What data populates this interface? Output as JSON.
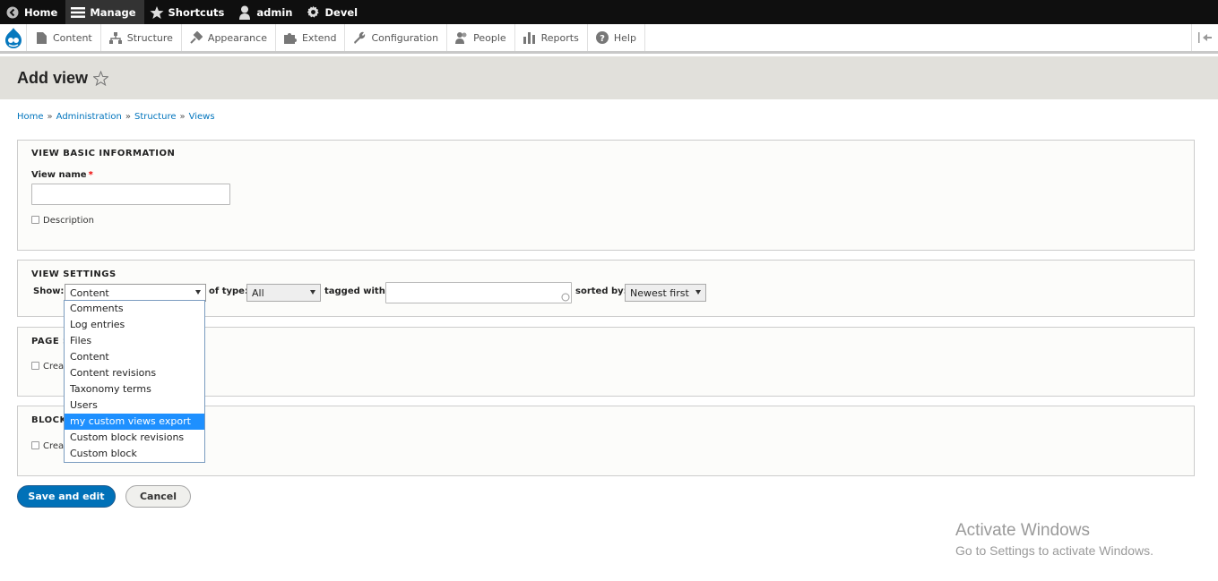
{
  "toolbar": {
    "items": [
      {
        "label": "Home",
        "icon": "back-circle-icon"
      },
      {
        "label": "Manage",
        "icon": "menu-icon"
      },
      {
        "label": "Shortcuts",
        "icon": "star-icon"
      },
      {
        "label": "admin",
        "icon": "user-icon"
      },
      {
        "label": "Devel",
        "icon": "gear-icon"
      }
    ]
  },
  "tray": {
    "items": [
      {
        "label": "Content",
        "icon": "document-icon"
      },
      {
        "label": "Structure",
        "icon": "structure-icon"
      },
      {
        "label": "Appearance",
        "icon": "brush-icon"
      },
      {
        "label": "Extend",
        "icon": "puzzle-icon"
      },
      {
        "label": "Configuration",
        "icon": "wrench-icon"
      },
      {
        "label": "People",
        "icon": "people-icon"
      },
      {
        "label": "Reports",
        "icon": "bar-chart-icon"
      },
      {
        "label": "Help",
        "icon": "help-icon"
      }
    ]
  },
  "page": {
    "title": "Add view"
  },
  "breadcrumb": [
    "Home",
    "Administration",
    "Structure",
    "Views"
  ],
  "breadcrumb_sep": "»",
  "basic": {
    "legend": "VIEW BASIC INFORMATION",
    "view_name_label": "View name",
    "required_mark": "*",
    "view_name_value": "",
    "description_label": "Description"
  },
  "settings": {
    "legend": "VIEW SETTINGS",
    "show_label": "Show:",
    "show_value": "Content",
    "of_type_label": "of type:",
    "of_type_value": "All",
    "tagged_label": "tagged with:",
    "tagged_value": "",
    "sorted_label": "sorted by:",
    "sorted_value": "Newest first"
  },
  "page_settings": {
    "legend": "PAGE S",
    "checkbox_label": "Crea"
  },
  "block_settings": {
    "legend": "BLOCK",
    "checkbox_label": "Crea"
  },
  "dropdown": {
    "options": [
      "Comments",
      "Log entries",
      "Files",
      "Content",
      "Content revisions",
      "Taxonomy terms",
      "Users",
      "my custom views export",
      "Custom block revisions",
      "Custom block"
    ],
    "highlighted": "my custom views export"
  },
  "actions": {
    "save_label": "Save and edit",
    "cancel_label": "Cancel"
  },
  "watermark": {
    "title": "Activate Windows",
    "subtitle": "Go to Settings to activate Windows."
  },
  "colors": {
    "link": "#0074bd",
    "primary_button": "#0071b8",
    "highlight": "#1e90ff",
    "toolbar": "#0f0f0f"
  }
}
